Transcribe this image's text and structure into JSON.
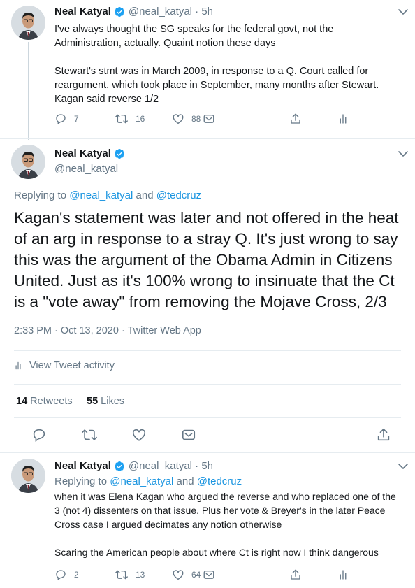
{
  "tweet1": {
    "name": "Neal Katyal",
    "handle": "@neal_katyal",
    "time": "5h",
    "paragraph1": "I've always thought the SG speaks for the federal govt, not the Administration, actually.  Quaint notion these days",
    "paragraph2": "Stewart's stmt was in March 2009, in response to a Q. Court called for reargument, which took place in September, many months after Stewart. Kagan said reverse 1/2",
    "replies": "7",
    "retweets": "16",
    "likes": "88"
  },
  "tweet2": {
    "name": "Neal Katyal",
    "handle": "@neal_katyal",
    "replying_prefix": "Replying to ",
    "reply_to_1": "@neal_katyal",
    "reply_and": " and ",
    "reply_to_2": "@tedcruz",
    "text": "Kagan's statement was later and not offered in the heat of an arg in response to a stray Q. It's just wrong to say this was the argument of the Obama Admin in Citizens United.  Just as it's 100% wrong to insinuate that the Ct is a \"vote away\" from removing the Mojave Cross, 2/3",
    "timestamp": "2:33 PM · Oct 13, 2020",
    "client": "Twitter Web App",
    "activity_label": "View Tweet activity",
    "retweets_count": "14",
    "retweets_label": "Retweets",
    "likes_count": "55",
    "likes_label": "Likes"
  },
  "tweet3": {
    "name": "Neal Katyal",
    "handle": "@neal_katyal",
    "time": "5h",
    "replying_prefix": "Replying to ",
    "reply_to_1": "@neal_katyal",
    "reply_and": " and ",
    "reply_to_2": "@tedcruz",
    "paragraph1": "when it was Elena Kagan who argued the reverse and who replaced one of the 3 (not 4) dissenters on that issue. Plus her vote & Breyer's in the later Peace Cross case I argued decimates any notion otherwise",
    "paragraph2": "Scaring the American people about where Ct is right now I think dangerous",
    "replies": "2",
    "retweets": "13",
    "likes": "64"
  },
  "icons": {
    "verified": "verified-badge-icon",
    "reply": "reply-icon",
    "retweet": "retweet-icon",
    "like": "heart-icon",
    "dm": "direct-message-icon",
    "share": "share-icon",
    "analytics": "analytics-icon",
    "more": "chevron-down-icon"
  },
  "colors": {
    "accent": "#1b95e0",
    "text": "#14171a",
    "secondary": "#657786",
    "divider": "#e6ecf0"
  }
}
